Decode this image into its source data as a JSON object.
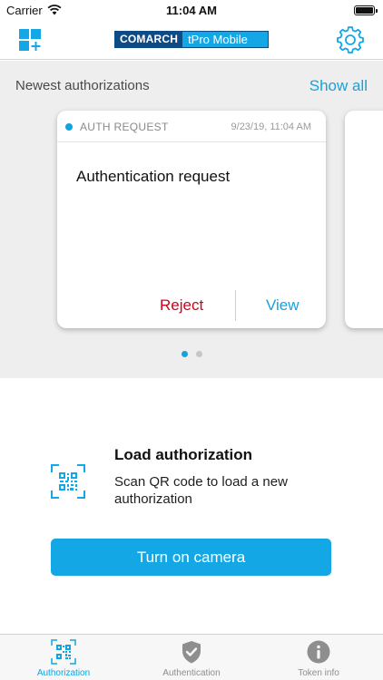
{
  "status_bar": {
    "carrier": "Carrier",
    "time": "11:04 AM"
  },
  "nav": {
    "brand_left": "COMARCH",
    "brand_right": "tPro Mobile"
  },
  "newest": {
    "title": "Newest authorizations",
    "show_all": "Show all"
  },
  "auth_card": {
    "type": "AUTH REQUEST",
    "date": "9/23/19, 11:04 AM",
    "title": "Authentication request",
    "reject": "Reject",
    "view": "View"
  },
  "pagination": {
    "current": 1,
    "total": 2
  },
  "load": {
    "title": "Load authorization",
    "description": "Scan QR code to load a new authorization",
    "button": "Turn on camera"
  },
  "tabs": [
    {
      "label": "Authorization",
      "icon": "qr-code-icon",
      "active": true
    },
    {
      "label": "Authentication",
      "icon": "shield-check-icon",
      "active": false
    },
    {
      "label": "Token info",
      "icon": "info-icon",
      "active": false
    }
  ],
  "colors": {
    "accent": "#13a8e5",
    "brand_dark": "#0e4a84",
    "reject": "#d0021b"
  }
}
